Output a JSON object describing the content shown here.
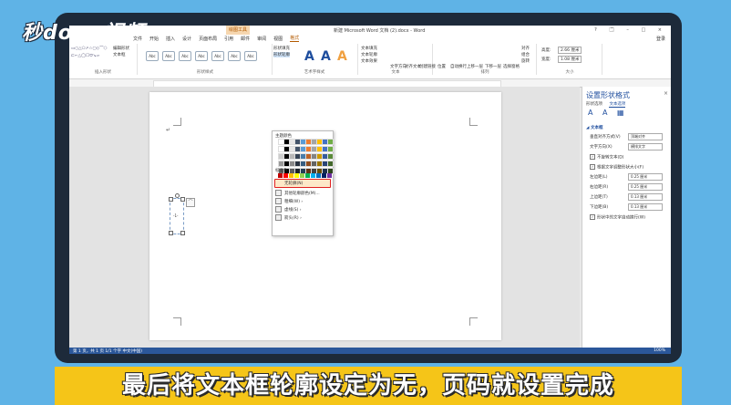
{
  "watermark": "秒dong视频",
  "window": {
    "title": "新建 Microsoft Word 文档 (2).docx - Word",
    "context_tab_group": "绘图工具",
    "controls": "? 🗔 – □ ×",
    "user": "登录"
  },
  "tabs": [
    {
      "label": "文件"
    },
    {
      "label": "开始"
    },
    {
      "label": "插入"
    },
    {
      "label": "设计"
    },
    {
      "label": "页面布局"
    },
    {
      "label": "引用"
    },
    {
      "label": "邮件"
    },
    {
      "label": "审阅"
    },
    {
      "label": "视图"
    },
    {
      "label": "格式",
      "active": true
    }
  ],
  "ribbon": {
    "groups": {
      "insert_shapes": "插入形状",
      "shape_styles": "形状样式",
      "art_styles": "艺术字样式",
      "text": "文本",
      "arrange": "排列",
      "size": "大小"
    },
    "edit_shape": "编辑形状",
    "text_box": "文本框",
    "shape_fill": "形状填充",
    "shape_outline": "形状轮廓",
    "style_btn": "Abc",
    "text_fill": "文本填充",
    "text_outline": "文本轮廓",
    "text_effects": "文本效果",
    "text_direction": "文字方向",
    "align_text": "对齐文本",
    "create_link": "创建链接",
    "position": "位置",
    "wrap_text": "自动换行",
    "bring_forward": "上移一层",
    "send_backward": "下移一层",
    "selection_pane": "选择窗格",
    "align": "对齐",
    "group": "组合",
    "rotate": "旋转",
    "height": "高度:",
    "height_val": "2.66 厘米",
    "width": "宽度:",
    "width_val": "1.08 厘米"
  },
  "outline_menu": {
    "theme_colors": "主题颜色",
    "standard_colors": "标准色",
    "no_outline": "无轮廓(N)",
    "other_colors": "其他轮廓颜色(M)...",
    "weight": "粗细(W)",
    "dashes": "虚线(S)",
    "arrows": "箭头(R)",
    "theme_palette": [
      "#ffffff",
      "#000000",
      "#e7e6e6",
      "#44546a",
      "#5b9bd5",
      "#ed7d31",
      "#a5a5a5",
      "#ffc000",
      "#4472c4",
      "#70ad47"
    ],
    "standard_palette": [
      "#c00000",
      "#ff0000",
      "#ffc000",
      "#ffff00",
      "#92d050",
      "#00b050",
      "#00b0f0",
      "#0070c0",
      "#002060",
      "#7030a0"
    ]
  },
  "document": {
    "textbox_content": "-1-"
  },
  "format_pane": {
    "title": "设置形状格式",
    "close": "×",
    "tab_shape": "形状选项",
    "tab_text": "文本选项",
    "section": "◢ 文本框",
    "rows": [
      {
        "label": "垂直对齐方式(V)",
        "value": "顶端对齐"
      },
      {
        "label": "文字方向(X)",
        "value": "横排文字"
      },
      {
        "label": "不旋转文本(D)",
        "check": true
      },
      {
        "label": "根据文字调整形状大小(F)",
        "check": true
      },
      {
        "label": "左边距(L)",
        "value": "0.25 厘米"
      },
      {
        "label": "右边距(R)",
        "value": "0.25 厘米"
      },
      {
        "label": "上边距(T)",
        "value": "0.13 厘米"
      },
      {
        "label": "下边距(B)",
        "value": "0.13 厘米"
      },
      {
        "label": "形状中的文字自动换行(W)",
        "check": true
      }
    ]
  },
  "statusbar": {
    "left": "第 1 页，共 1 页   1/1 个字   中文(中国)",
    "right": "100%"
  },
  "caption": "最后将文本框轮廓设定为无，页码就设置完成"
}
